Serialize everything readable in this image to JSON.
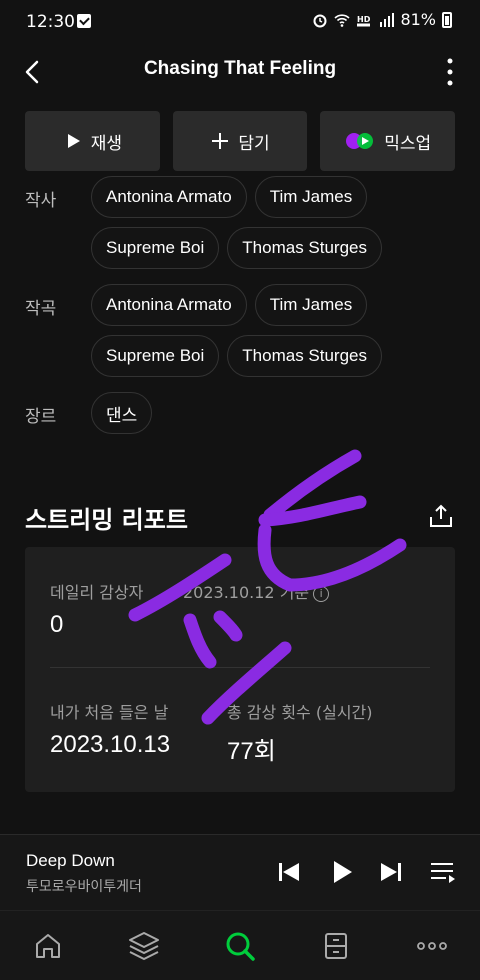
{
  "status_bar": {
    "time": "12:30",
    "battery": "81%"
  },
  "header": {
    "title": "Chasing That Feeling"
  },
  "actions": [
    {
      "label": "재생",
      "icon": "play-icon"
    },
    {
      "label": "담기",
      "icon": "plus-icon"
    },
    {
      "label": "믹스업",
      "icon": "mixup-icon"
    }
  ],
  "credits": {
    "lyricist": {
      "label": "작사",
      "names": [
        "Antonina Armato",
        "Tim James",
        "Supreme Boi",
        "Thomas Sturges"
      ]
    },
    "composer": {
      "label": "작곡",
      "names": [
        "Antonina Armato",
        "Tim James",
        "Supreme Boi",
        "Thomas Sturges"
      ]
    },
    "genre": {
      "label": "장르",
      "names": [
        "댄스"
      ]
    }
  },
  "report": {
    "title": "스트리밍 리포트",
    "daily_label": "데일리 감상자",
    "daily_date": "2023.10.12 기준",
    "daily_value": "0",
    "first_label": "내가 처음 들은 날",
    "first_value": "2023.10.13",
    "total_label": "총 감상 횟수 (실시간)",
    "total_value": "77회"
  },
  "now_playing": {
    "title": "Deep Down",
    "artist": "투모로우바이투게더"
  },
  "nav": [
    "home-icon",
    "layers-icon",
    "search-icon",
    "storage-icon",
    "more-icon"
  ],
  "colors": {
    "accent": "#00cd3c",
    "background": "#121212",
    "scribble": "#8a2be2"
  }
}
